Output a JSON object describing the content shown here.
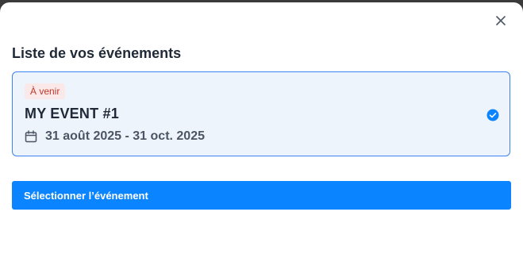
{
  "modal": {
    "title": "Liste de vos événements",
    "close_icon": "close-icon"
  },
  "events": [
    {
      "status": "À venir",
      "name": "MY EVENT #1",
      "dates": "31 août 2025 - 31 oct. 2025",
      "date_icon": "calendar-icon",
      "selected": true,
      "selected_icon": "check-circle-icon"
    }
  ],
  "actions": {
    "select_label": "Sélectionner l’événement"
  },
  "colors": {
    "accent": "#0a84ff",
    "card_border": "#3b82f6",
    "card_background": "#eef4fb",
    "badge_text": "#c0392b",
    "badge_background": "#fbe8e8",
    "title_text": "#1f2937",
    "backdrop": "#3a3a3a"
  }
}
